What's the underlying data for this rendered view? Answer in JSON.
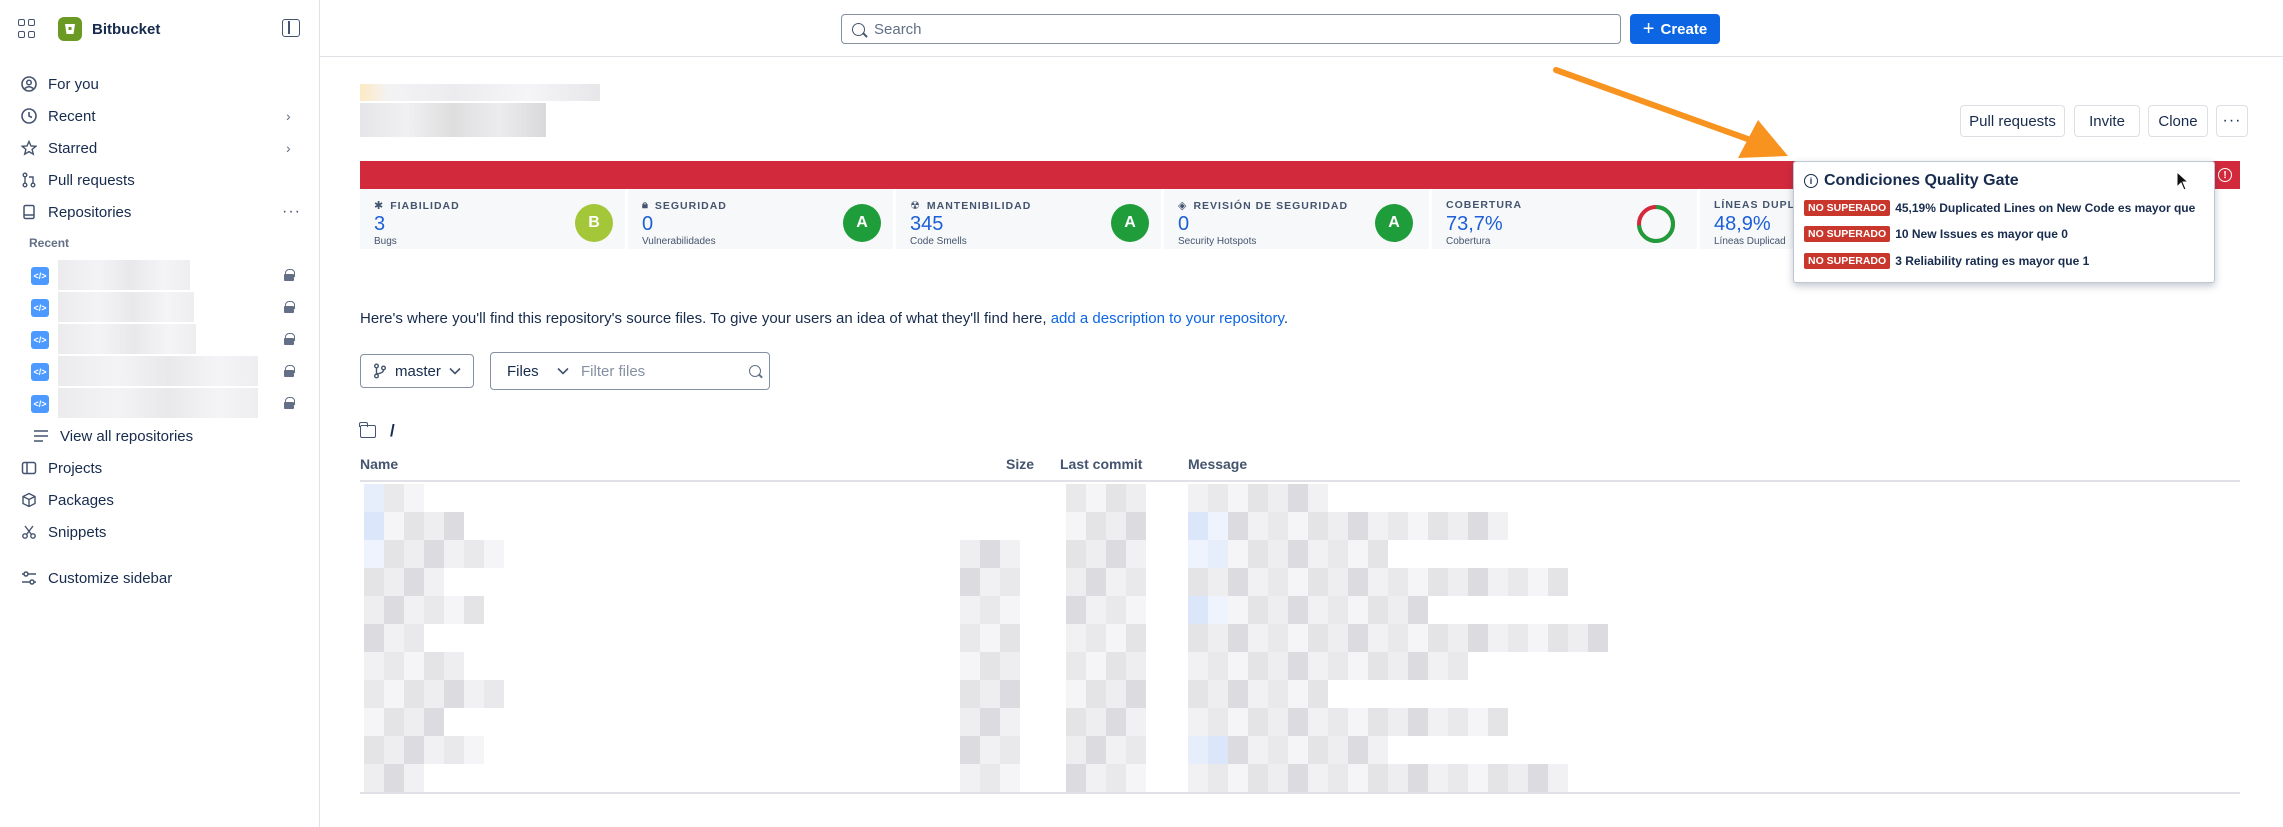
{
  "app": {
    "name": "Bitbucket"
  },
  "sidebar": {
    "items": [
      {
        "label": "For you",
        "icon": "user-circle-icon"
      },
      {
        "label": "Recent",
        "icon": "clock-icon"
      },
      {
        "label": "Starred",
        "icon": "star-icon"
      },
      {
        "label": "Pull requests",
        "icon": "pull-request-icon"
      },
      {
        "label": "Repositories",
        "icon": "repository-icon"
      }
    ],
    "recent_label": "Recent",
    "view_all": "View all repositories",
    "lower_items": [
      {
        "label": "Projects",
        "icon": "folder-icon"
      },
      {
        "label": "Packages",
        "icon": "package-icon"
      },
      {
        "label": "Snippets",
        "icon": "scissors-icon"
      }
    ],
    "customize": "Customize sidebar"
  },
  "topbar": {
    "search_placeholder": "Search",
    "create_label": "Create"
  },
  "repo_header": {
    "buttons": {
      "pull_requests": "Pull requests",
      "invite": "Invite",
      "clone": "Clone"
    }
  },
  "quality_gate": {
    "metrics": [
      {
        "label": "FIABILIDAD",
        "value": "3",
        "sub": "Bugs",
        "grade": "B",
        "grade_color": "#a4c639",
        "icon": "bug-icon"
      },
      {
        "label": "SEGURIDAD",
        "value": "0",
        "sub": "Vulnerabilidades",
        "grade": "A",
        "grade_color": "#1f9d3a",
        "icon": "lock-icon"
      },
      {
        "label": "MANTENIBILIDAD",
        "value": "345",
        "sub": "Code Smells",
        "grade": "A",
        "grade_color": "#1f9d3a",
        "icon": "maintainability-icon"
      },
      {
        "label": "REVISIÓN DE SEGURIDAD",
        "value": "0",
        "sub": "Security Hotspots",
        "grade": "A",
        "grade_color": "#1f9d3a",
        "icon": "shield-check-icon"
      },
      {
        "label": "COBERTURA",
        "value": "73,7%",
        "sub": "Cobertura",
        "coverage_fraction": 0.737
      },
      {
        "label": "LÍNEAS DUPL",
        "value": "48,9%",
        "sub": "Líneas Duplicad"
      }
    ],
    "popover": {
      "title": "Condiciones Quality Gate",
      "conditions": [
        {
          "badge": "NO SUPERADO",
          "text": "45,19% Duplicated Lines on New Code es mayor que"
        },
        {
          "badge": "NO SUPERADO",
          "text": "10 New Issues es mayor que 0"
        },
        {
          "badge": "NO SUPERADO",
          "text": "3 Reliability rating es mayor que 1"
        }
      ]
    },
    "bar_color": "#d3293d"
  },
  "source": {
    "description_text": "Here's where you'll find this repository's source files. To give your users an idea of what they'll find here,",
    "description_link": "add a description to your repository",
    "description_end": ".",
    "branch": "master",
    "files_select": "Files",
    "filter_placeholder": "Filter files",
    "path": "/",
    "columns": {
      "name": "Name",
      "size": "Size",
      "last_commit": "Last commit",
      "message": "Message"
    }
  },
  "colors": {
    "accent": "#0c66e4",
    "fail": "#c9372c",
    "annotation_arrow": "#f7931e"
  }
}
